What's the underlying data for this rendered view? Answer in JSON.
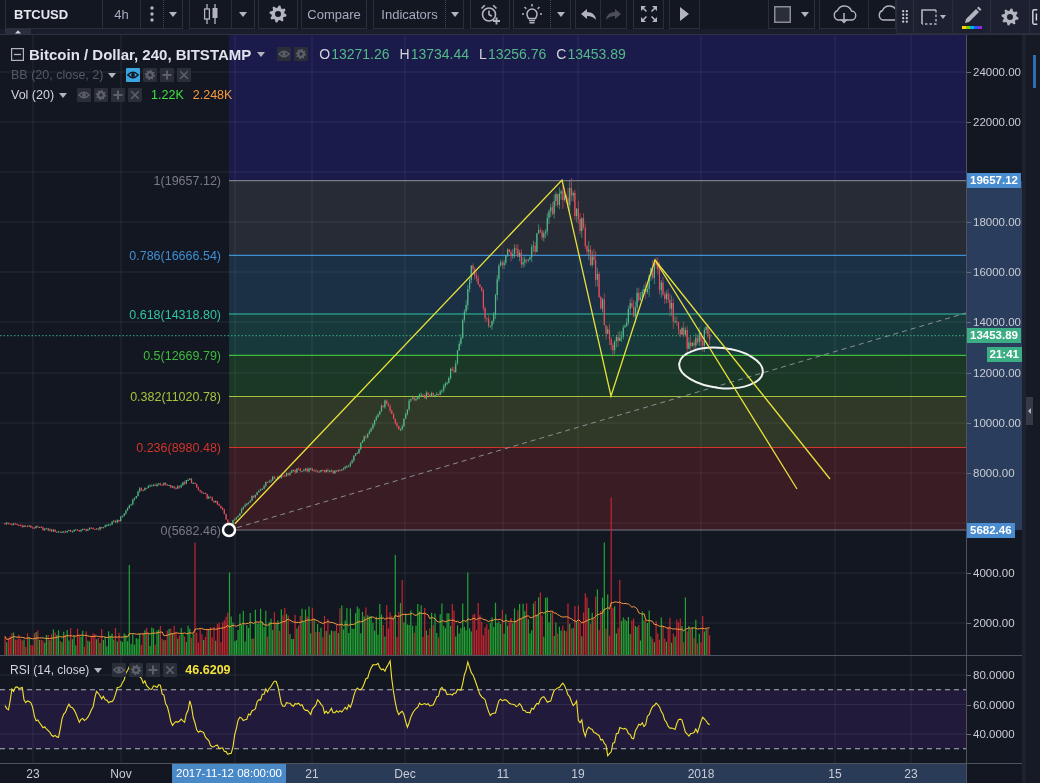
{
  "toolbar": {
    "symbol": "BTCUSD",
    "interval": "4h",
    "compare": "Compare",
    "indicators": "Indicators",
    "history": [
      {
        "kind": "undo",
        "disabled": false
      },
      {
        "kind": "redo",
        "disabled": true
      }
    ]
  },
  "legend": {
    "title": "Bitcoin / Dollar, 240, BITSTAMP",
    "ohlc": [
      {
        "key": "O",
        "value": "13271.26"
      },
      {
        "key": "H",
        "value": "13734.44"
      },
      {
        "key": "L",
        "value": "13256.76"
      },
      {
        "key": "C",
        "value": "13453.89"
      }
    ],
    "indicators": [
      {
        "kind": "bollinger",
        "label": "BB (20, close, 2)",
        "hidden": true
      },
      {
        "kind": "volume",
        "label": "Vol (20)",
        "hidden": false,
        "values": [
          {
            "text": "1.22K",
            "color": "#3ee03e"
          },
          {
            "text": "2.248K",
            "color": "#f89a3c"
          }
        ]
      }
    ]
  },
  "fib_levels": [
    {
      "label": "1(19657.12)",
      "color": "#787b86"
    },
    {
      "label": "0.786(16666.54)",
      "color": "#3d8fd1"
    },
    {
      "label": "0.618(14318.80)",
      "color": "#2fc4a2"
    },
    {
      "label": "0.5(12669.79)",
      "color": "#3bbd3b"
    },
    {
      "label": "0.382(11020.78)",
      "color": "#a5c43c"
    },
    {
      "label": "0.236(8980.48)",
      "color": "#d2342c"
    },
    {
      "label": "0(5682.46)",
      "color": "#787b86"
    }
  ],
  "price_axis": {
    "ticks": [
      "24000.00",
      "22000.00",
      "18000.00",
      "16000.00",
      "14000.00",
      "12000.00",
      "10000.00",
      "8000.00",
      "4000.00",
      "2000.00"
    ],
    "badges": [
      {
        "kind": "price",
        "text": "19657.12",
        "color": "#4a8cd0"
      },
      {
        "kind": "price",
        "text": "13453.89",
        "color": "#3cae84"
      },
      {
        "kind": "countdown",
        "text": "21:41",
        "color": "#3cae84"
      },
      {
        "kind": "price",
        "text": "5682.46",
        "color": "#4a8cd0"
      }
    ]
  },
  "rsi": {
    "label": "RSI (14, close)",
    "value": "46.6209",
    "ticks": [
      "80.0000",
      "60.0000",
      "40.0000"
    ]
  },
  "time_axis": {
    "ticks": [
      "23",
      "Nov",
      "21",
      "Dec",
      "11",
      "19",
      "2018",
      "15",
      "23"
    ],
    "cursor_label": "2017-11-12 08:00:00"
  }
}
